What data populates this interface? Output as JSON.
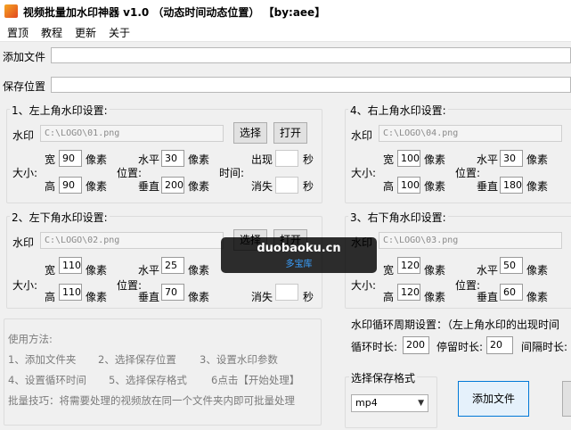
{
  "window": {
    "title": "视频批量加水印神器 v1.0 （动态时间动态位置） 【by:aee】"
  },
  "menu": [
    "置顶",
    "教程",
    "更新",
    "关于"
  ],
  "add_files_label": "添加文件",
  "save_location_label": "保存位置",
  "units": {
    "width": "宽",
    "height": "高",
    "px": "像素",
    "size": "大小:",
    "horizontal": "水平",
    "vertical": "垂直",
    "position": "位置:",
    "time": "时间:",
    "appear": "出现",
    "disappear": "消失",
    "seconds": "秒",
    "watermark": "水印"
  },
  "buttons": {
    "choose": "选择",
    "open": "打开"
  },
  "panels": {
    "top_left": {
      "title": "1、左上角水印设置:",
      "path": "C:\\LOGO\\01.png",
      "width": "90",
      "height": "90",
      "h": "30",
      "v": "200"
    },
    "bottom_left": {
      "title": "2、左下角水印设置:",
      "path": "C:\\LOGO\\02.png",
      "width": "110",
      "height": "110",
      "h": "25",
      "v": "70"
    },
    "top_right": {
      "title": "4、右上角水印设置:",
      "path": "C:\\LOGO\\04.png",
      "width": "100",
      "height": "100",
      "h": "30",
      "v": "180"
    },
    "bottom_right": {
      "title": "3、右下角水印设置:",
      "path": "C:\\LOGO\\03.png",
      "width": "120",
      "height": "120",
      "h": "50",
      "v": "60"
    }
  },
  "usage": {
    "heading": "使用方法:",
    "step1": "1、添加文件夹",
    "step2": "2、选择保存位置",
    "step3": "3、设置水印参数",
    "step4": "4、设置循环时间",
    "step5": "5、选择保存格式",
    "step6": "6点击【开始处理】",
    "tip": "批量技巧：将需要处理的视频放在同一个文件夹内即可批量处理"
  },
  "cycle": {
    "title": "水印循环周期设置：（左上角水印的出现时间",
    "loop_label": "循环时长:",
    "loop_value": "200",
    "stay_label": "停留时长:",
    "stay_value": "20",
    "interval_label": "间隔时长:"
  },
  "format": {
    "label": "选择保存格式",
    "selected": "mp4"
  },
  "add_file_button": "添加文件",
  "overlay": {
    "site": "duobaoku.cn",
    "name": "多宝库"
  }
}
